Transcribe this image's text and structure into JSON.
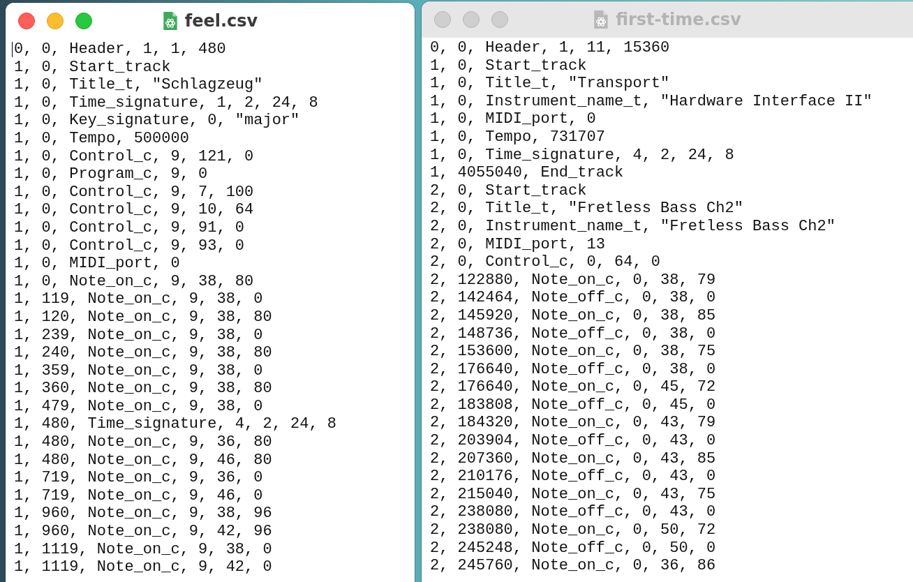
{
  "windows": [
    {
      "title": "feel.csv",
      "active": true,
      "lines": [
        "0, 0, Header, 1, 1, 480",
        "1, 0, Start_track",
        "1, 0, Title_t, \"Schlagzeug\"",
        "1, 0, Time_signature, 1, 2, 24, 8",
        "1, 0, Key_signature, 0, \"major\"",
        "1, 0, Tempo, 500000",
        "1, 0, Control_c, 9, 121, 0",
        "1, 0, Program_c, 9, 0",
        "1, 0, Control_c, 9, 7, 100",
        "1, 0, Control_c, 9, 10, 64",
        "1, 0, Control_c, 9, 91, 0",
        "1, 0, Control_c, 9, 93, 0",
        "1, 0, MIDI_port, 0",
        "1, 0, Note_on_c, 9, 38, 80",
        "1, 119, Note_on_c, 9, 38, 0",
        "1, 120, Note_on_c, 9, 38, 80",
        "1, 239, Note_on_c, 9, 38, 0",
        "1, 240, Note_on_c, 9, 38, 80",
        "1, 359, Note_on_c, 9, 38, 0",
        "1, 360, Note_on_c, 9, 38, 80",
        "1, 479, Note_on_c, 9, 38, 0",
        "1, 480, Time_signature, 4, 2, 24, 8",
        "1, 480, Note_on_c, 9, 36, 80",
        "1, 480, Note_on_c, 9, 46, 80",
        "1, 719, Note_on_c, 9, 36, 0",
        "1, 719, Note_on_c, 9, 46, 0",
        "1, 960, Note_on_c, 9, 38, 96",
        "1, 960, Note_on_c, 9, 42, 96",
        "1, 1119, Note_on_c, 9, 38, 0",
        "1, 1119, Note_on_c, 9, 42, 0"
      ]
    },
    {
      "title": "first-time.csv",
      "active": false,
      "lines": [
        "0, 0, Header, 1, 11, 15360",
        "1, 0, Start_track",
        "1, 0, Title_t, \"Transport\"",
        "1, 0, Instrument_name_t, \"Hardware Interface II\"",
        "1, 0, MIDI_port, 0",
        "1, 0, Tempo, 731707",
        "1, 0, Time_signature, 4, 2, 24, 8",
        "1, 4055040, End_track",
        "2, 0, Start_track",
        "2, 0, Title_t, \"Fretless Bass Ch2\"",
        "2, 0, Instrument_name_t, \"Fretless Bass Ch2\"",
        "2, 0, MIDI_port, 13",
        "2, 0, Control_c, 0, 64, 0",
        "2, 122880, Note_on_c, 0, 38, 79",
        "2, 142464, Note_off_c, 0, 38, 0",
        "2, 145920, Note_on_c, 0, 38, 85",
        "2, 148736, Note_off_c, 0, 38, 0",
        "2, 153600, Note_on_c, 0, 38, 75",
        "2, 176640, Note_off_c, 0, 38, 0",
        "2, 176640, Note_on_c, 0, 45, 72",
        "2, 183808, Note_off_c, 0, 45, 0",
        "2, 184320, Note_on_c, 0, 43, 79",
        "2, 203904, Note_off_c, 0, 43, 0",
        "2, 207360, Note_on_c, 0, 43, 85",
        "2, 210176, Note_off_c, 0, 43, 0",
        "2, 215040, Note_on_c, 0, 43, 75",
        "2, 238080, Note_off_c, 0, 43, 0",
        "2, 238080, Note_on_c, 0, 50, 72",
        "2, 245248, Note_off_c, 0, 50, 0",
        "2, 245760, Note_on_c, 0, 36, 86"
      ]
    }
  ]
}
